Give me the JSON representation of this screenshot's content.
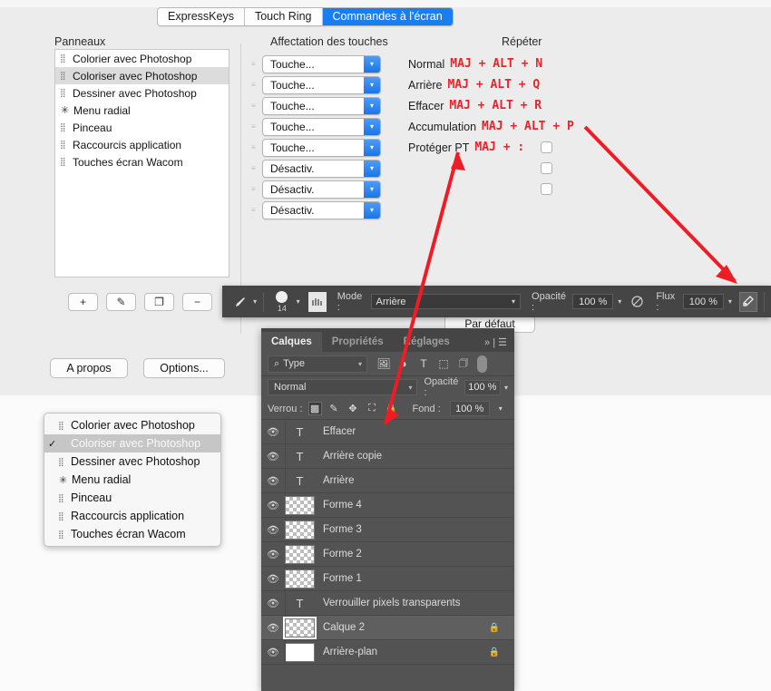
{
  "wacom": {
    "tabs": [
      {
        "label": "ExpressKeys",
        "active": false
      },
      {
        "label": "Touch Ring",
        "active": false
      },
      {
        "label": "Commandes à l'écran",
        "active": true
      }
    ],
    "panneaux_label": "Panneaux",
    "affectation_label": "Affectation des touches",
    "repeter_label": "Répéter",
    "panneaux_items": [
      {
        "label": "Colorier avec Photoshop",
        "icon": "grip-icon",
        "selected": false
      },
      {
        "label": "Coloriser avec Photoshop",
        "icon": "grip-icon",
        "selected": true
      },
      {
        "label": "Dessiner avec Photoshop",
        "icon": "grip-icon",
        "selected": false
      },
      {
        "label": "Menu radial",
        "icon": "radial-menu-icon",
        "selected": false
      },
      {
        "label": "Pinceau",
        "icon": "grip-icon",
        "selected": false
      },
      {
        "label": "Raccourcis application",
        "icon": "grip-icon",
        "selected": false
      },
      {
        "label": "Touches écran Wacom",
        "icon": "grip-icon",
        "selected": false
      }
    ],
    "key_popups": [
      "Touche...",
      "Touche...",
      "Touche...",
      "Touche...",
      "Touche...",
      "Désactiv.",
      "Désactiv.",
      "Désactiv."
    ],
    "shortcuts": [
      {
        "label": "Normal",
        "keys": "MAJ + ALT + N"
      },
      {
        "label": "Arrière",
        "keys": "MAJ + ALT + Q"
      },
      {
        "label": "Effacer",
        "keys": "MAJ + ALT + R"
      },
      {
        "label": "Accumulation",
        "keys": "MAJ + ALT + P"
      },
      {
        "label": "Protéger PT",
        "keys": "MAJ + :"
      }
    ],
    "tool_buttons": [
      {
        "name": "add-button",
        "glyph": "+"
      },
      {
        "name": "edit-button",
        "glyph": "✎"
      },
      {
        "name": "duplicate-button",
        "glyph": "❐"
      },
      {
        "name": "remove-button",
        "glyph": "−"
      }
    ],
    "about_label": "A propos",
    "options_label": "Options...",
    "par_defaut_label": "Par défaut"
  },
  "photoshop_options": {
    "brush_size": "14",
    "mode_label": "Mode :",
    "mode_value": "Arrière",
    "opacity_label": "Opacité :",
    "opacity_value": "100 %",
    "flow_label": "Flux :",
    "flow_value": "100 %"
  },
  "layers_panel": {
    "tabs": [
      {
        "label": "Calques",
        "active": true
      },
      {
        "label": "Propriétés",
        "active": false
      },
      {
        "label": "Réglages",
        "active": false
      }
    ],
    "filter_label": "Type",
    "filter_icons": [
      "image-filter-icon",
      "adjustment-filter-icon",
      "type-filter-icon",
      "shape-filter-icon",
      "smart-object-filter-icon"
    ],
    "blend_mode": "Normal",
    "opacity_label": "Opacité :",
    "opacity_value": "100 %",
    "lock_label": "Verrou :",
    "lock_icons": [
      "lock-transparent-pixels-icon",
      "lock-image-pixels-icon",
      "lock-position-icon",
      "lock-artboard-icon",
      "lock-all-icon"
    ],
    "fill_label": "Fond :",
    "fill_value": "100 %",
    "layers": [
      {
        "name": "Effacer",
        "thumb": "text",
        "visible": true,
        "locked": false,
        "selected": false
      },
      {
        "name": "Arrière copie",
        "thumb": "text",
        "visible": true,
        "locked": false,
        "selected": false
      },
      {
        "name": "Arrière",
        "thumb": "text",
        "visible": true,
        "locked": false,
        "selected": false
      },
      {
        "name": "Forme 4",
        "thumb": "shape",
        "visible": true,
        "locked": false,
        "selected": false
      },
      {
        "name": "Forme 3",
        "thumb": "shape",
        "visible": true,
        "locked": false,
        "selected": false
      },
      {
        "name": "Forme 2",
        "thumb": "shape",
        "visible": true,
        "locked": false,
        "selected": false
      },
      {
        "name": "Forme 1",
        "thumb": "shape",
        "visible": true,
        "locked": false,
        "selected": false
      },
      {
        "name": "Verrouiller pixels transparents",
        "thumb": "text",
        "visible": true,
        "locked": false,
        "selected": false
      },
      {
        "name": "Calque 2",
        "thumb": "pixel",
        "visible": true,
        "locked": true,
        "selected": true
      },
      {
        "name": "Arrière-plan",
        "thumb": "white",
        "visible": true,
        "locked": true,
        "selected": false
      }
    ]
  },
  "popup_menu": {
    "items": [
      {
        "label": "Colorier avec Photoshop",
        "icon": "grip-icon",
        "checked": false,
        "selected": false
      },
      {
        "label": "Coloriser avec Photoshop",
        "icon": "grip-icon",
        "checked": true,
        "selected": true
      },
      {
        "label": "Dessiner avec Photoshop",
        "icon": "grip-icon",
        "checked": false,
        "selected": false
      },
      {
        "label": "Menu radial",
        "icon": "radial-menu-icon",
        "checked": false,
        "selected": false
      },
      {
        "label": "Pinceau",
        "icon": "grip-icon",
        "checked": false,
        "selected": false
      },
      {
        "label": "Raccourcis application",
        "icon": "grip-icon",
        "checked": false,
        "selected": false
      },
      {
        "label": "Touches écran Wacom",
        "icon": "grip-icon",
        "checked": false,
        "selected": false
      }
    ]
  },
  "annotations": {
    "arrow_color": "#ee1c25",
    "arrows": [
      {
        "name": "arrow-to-blend-mode"
      },
      {
        "name": "arrow-to-airbrush-toggle"
      }
    ]
  }
}
